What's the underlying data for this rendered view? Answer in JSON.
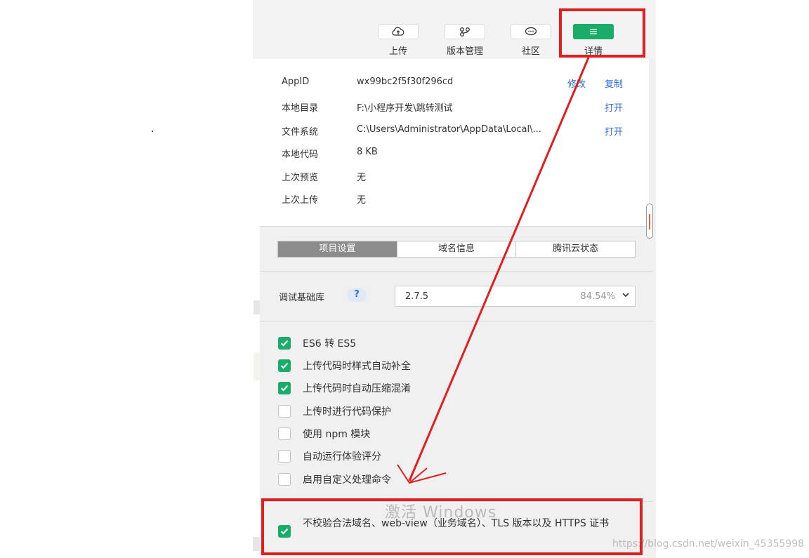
{
  "toolbar": {
    "items": [
      {
        "label": "上传",
        "icon": "cloud-upload-icon"
      },
      {
        "label": "版本管理",
        "icon": "version-branch-icon"
      },
      {
        "label": "社区",
        "icon": "chat-bubble-icon"
      },
      {
        "label": "详情",
        "icon": "menu-lines-icon"
      }
    ],
    "accent": "#1aad6a"
  },
  "info": {
    "appid": {
      "key": "AppID",
      "value": "wx99bc2f5f30f296cd",
      "modify": "修改",
      "copy": "复制"
    },
    "local_dir": {
      "key": "本地目录",
      "value": "F:\\小程序开发\\跳转测试",
      "action": "打开"
    },
    "file_system": {
      "key": "文件系统",
      "value": "C:\\Users\\Administrator\\AppData\\Local\\...",
      "action": "打开"
    },
    "local_code": {
      "key": "本地代码",
      "value": "8 KB"
    },
    "last_preview": {
      "key": "上次预览",
      "value": "无"
    },
    "last_upload": {
      "key": "上次上传",
      "value": "无"
    }
  },
  "tabs": [
    "项目设置",
    "域名信息",
    "腾讯云状态"
  ],
  "debug_lib": {
    "label": "调试基础库",
    "help": "?",
    "version": "2.7.5",
    "percent": "84.54%"
  },
  "options": [
    {
      "label": "ES6 转 ES5",
      "checked": true
    },
    {
      "label": "上传代码时样式自动补全",
      "checked": true
    },
    {
      "label": "上传代码时自动压缩混淆",
      "checked": true
    },
    {
      "label": "上传时进行代码保护",
      "checked": false
    },
    {
      "label": "使用 npm 模块",
      "checked": false
    },
    {
      "label": "自动运行体验评分",
      "checked": false
    },
    {
      "label": "启用自定义处理命令",
      "checked": false
    },
    {
      "label": "不校验合法域名、web-view（业务域名）、TLS 版本以及 HTTPS 证书",
      "checked": true
    }
  ],
  "watermark": "激活 Windows",
  "site_watermark": "https://blog.csdn.net/weixin_45355998",
  "annotation_color": "#e02020"
}
